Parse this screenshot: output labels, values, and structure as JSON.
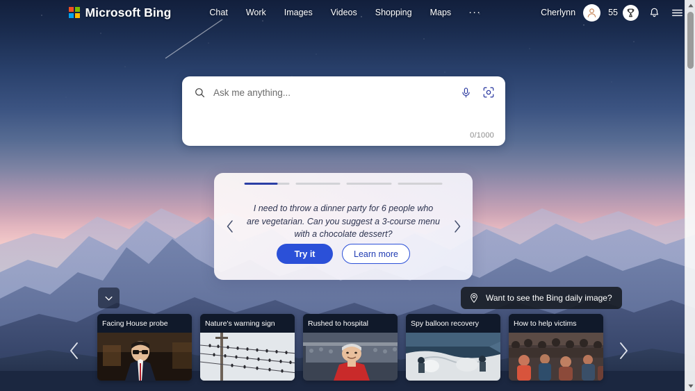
{
  "brand": {
    "name": "Microsoft Bing",
    "logo_icon": "microsoft-squares-icon"
  },
  "nav": {
    "items": [
      {
        "label": "Chat"
      },
      {
        "label": "Work"
      },
      {
        "label": "Images"
      },
      {
        "label": "Videos"
      },
      {
        "label": "Shopping"
      },
      {
        "label": "Maps"
      }
    ],
    "more_label": "···"
  },
  "account": {
    "user_name": "Cherlynn",
    "avatar_icon": "person-avatar-icon",
    "rewards_count": "55",
    "rewards_icon": "trophy-icon",
    "notifications_icon": "bell-icon",
    "menu_icon": "hamburger-menu-icon"
  },
  "search": {
    "placeholder": "Ask me anything...",
    "value": "",
    "char_counter": "0/1000",
    "search_icon": "search-icon",
    "mic_icon": "microphone-icon",
    "visual_search_icon": "visual-search-camera-icon"
  },
  "suggestion": {
    "text": "I need to throw a dinner party for 6 people who are vegetarian. Can you suggest a 3-course menu with a chocolate dessert?",
    "try_label": "Try it",
    "learn_label": "Learn more",
    "prev_icon": "chevron-left-icon",
    "next_icon": "chevron-right-icon",
    "progress": [
      {
        "fill_percent": 74,
        "active": true
      },
      {
        "fill_percent": 0,
        "active": false
      },
      {
        "fill_percent": 0,
        "active": false
      },
      {
        "fill_percent": 0,
        "active": false
      }
    ],
    "active_color": "#2b3fa5",
    "track_color": "#d2d2d6"
  },
  "daily_image_pill": {
    "label": "Want to see the Bing daily image?",
    "icon": "location-pin-icon"
  },
  "feed": {
    "toggle_icon": "chevron-down-icon",
    "prev_icon": "chevron-left-icon",
    "next_icon": "chevron-right-icon",
    "cards": [
      {
        "title": "Facing House probe"
      },
      {
        "title": "Nature's warning sign"
      },
      {
        "title": "Rushed to hospital"
      },
      {
        "title": "Spy balloon recovery"
      },
      {
        "title": "How to help victims"
      }
    ]
  },
  "scrollbar": {
    "up_icon": "scroll-up-arrow-icon",
    "down_icon": "scroll-down-arrow-icon"
  },
  "theme": {
    "accent_blue": "#2b50d8",
    "progress_blue": "#2b3fa5",
    "overlay_dark": "#161a21"
  }
}
